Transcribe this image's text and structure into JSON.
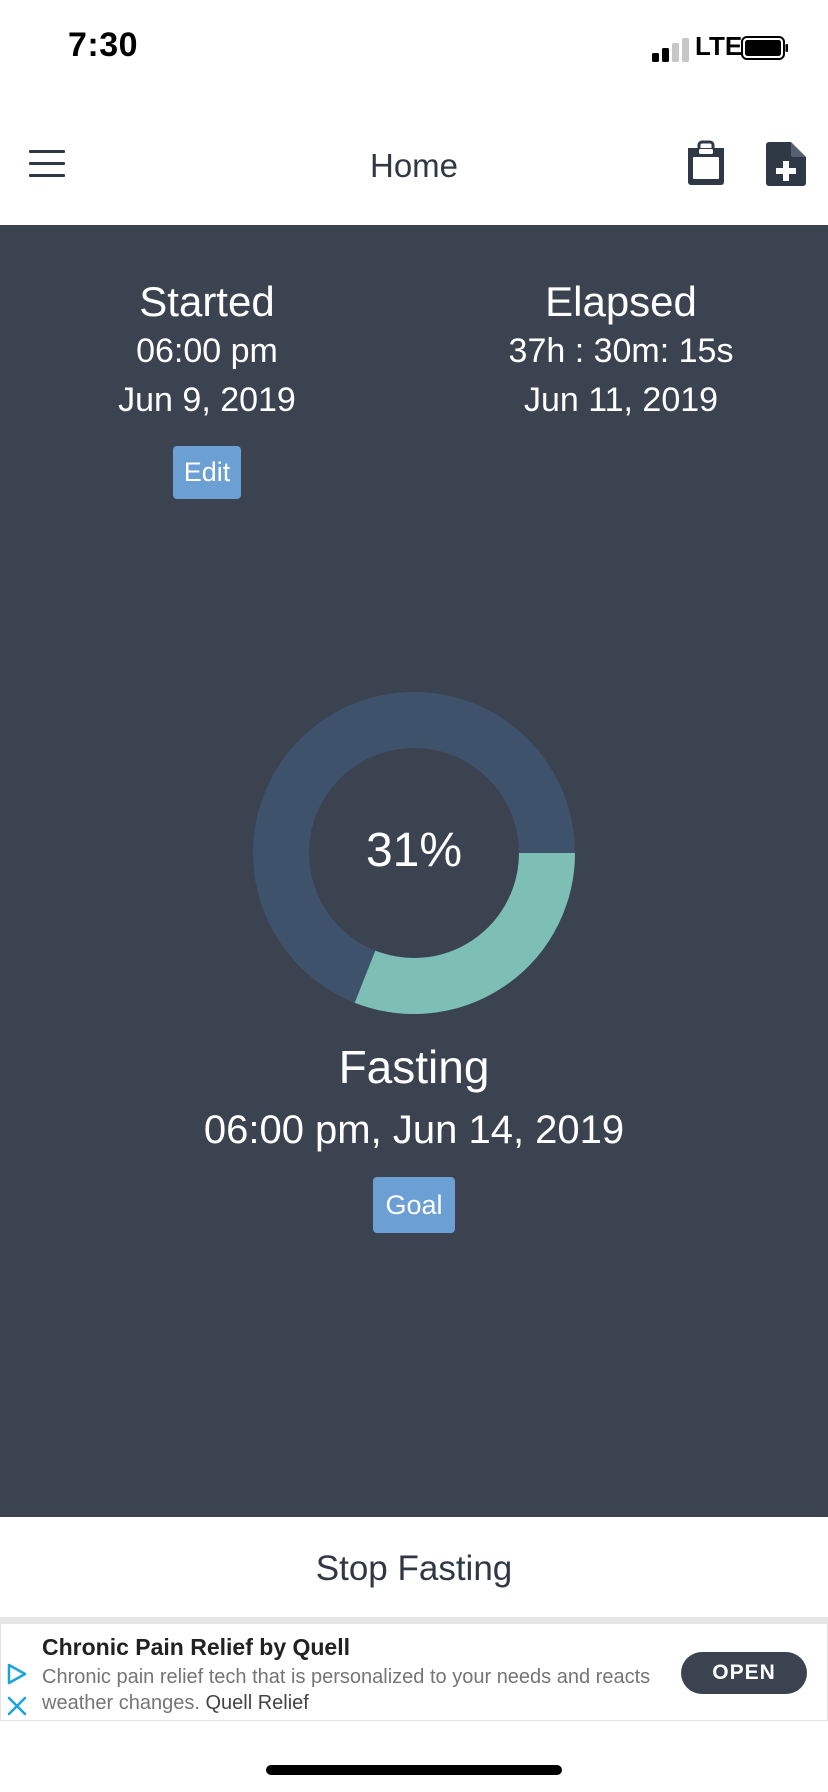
{
  "status_bar": {
    "time": "7:30",
    "network": "LTE"
  },
  "nav": {
    "title": "Home",
    "menu_icon": "hamburger-menu-icon",
    "left_action_icon": "shopping-bag-icon",
    "right_action_icon": "new-document-icon"
  },
  "started": {
    "heading": "Started",
    "time": "06:00 pm",
    "date": "Jun 9, 2019",
    "edit_label": "Edit"
  },
  "elapsed": {
    "heading": "Elapsed",
    "duration": "37h : 30m: 15s",
    "date": "Jun 11, 2019"
  },
  "progress": {
    "percent_label": "31%",
    "fraction": 0.31
  },
  "status": {
    "label": "Fasting",
    "goal_datetime": "06:00 pm, Jun 14, 2019",
    "goal_label": "Goal"
  },
  "stop_label": "Stop Fasting",
  "ad": {
    "title": "Chronic Pain Relief by Quell",
    "body": "Chronic pain relief tech that is personalized to your needs and reacts weather changes.",
    "brand": "Quell Relief",
    "cta": "OPEN"
  },
  "colors": {
    "background_main": "#3b4350",
    "ring_track": "#3f526b",
    "ring_progress": "#7dbfb5",
    "button_blue": "#6c9fd4",
    "accent_text": "#2f3945"
  }
}
